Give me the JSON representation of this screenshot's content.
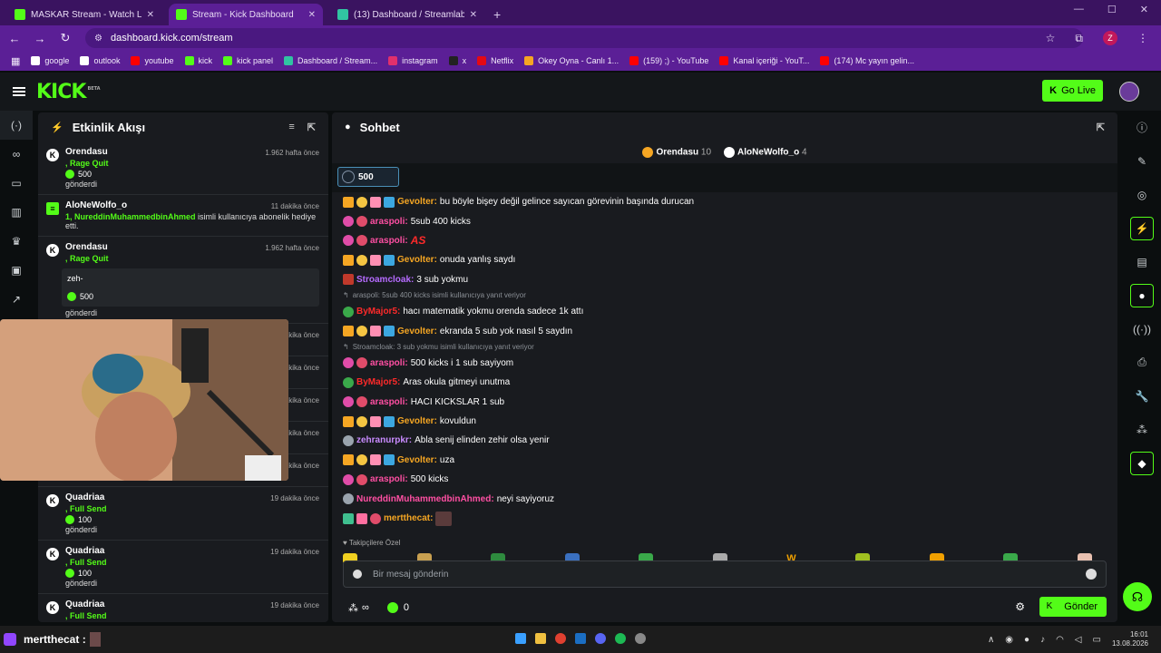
{
  "browser": {
    "tabs": [
      {
        "title": "MASKAR Stream - Watch Live o",
        "color": "#53fc18",
        "active": false
      },
      {
        "title": "Stream - Kick Dashboard",
        "color": "#53fc18",
        "active": true
      },
      {
        "title": "(13) Dashboard / Streamlabs",
        "color": "#31c3a2",
        "active": false
      }
    ],
    "url": "dashboard.kick.com/stream",
    "profile_letter": "Z",
    "bookmarks": [
      {
        "label": "google",
        "color": "#ffffff"
      },
      {
        "label": "outlook",
        "color": "#ffffff"
      },
      {
        "label": "youtube",
        "color": "#ff0000"
      },
      {
        "label": "kick",
        "color": "#53fc18"
      },
      {
        "label": "kick panel",
        "color": "#53fc18"
      },
      {
        "label": "Dashboard / Stream...",
        "color": "#31c3a2"
      },
      {
        "label": "instagram",
        "color": "#e1306c"
      },
      {
        "label": "x",
        "color": "#222222"
      },
      {
        "label": "Netflix",
        "color": "#e50914"
      },
      {
        "label": "Okey Oyna - Canlı 1...",
        "color": "#f5a623"
      },
      {
        "label": "(159) ;) - YouTube",
        "color": "#ff0000"
      },
      {
        "label": "Kanal içeriği - YouT...",
        "color": "#ff0000"
      },
      {
        "label": "(174) Mc yayın gelin...",
        "color": "#ff0000"
      }
    ]
  },
  "header": {
    "logo": "KICK",
    "logo_tag": "BETA",
    "go_live": "Go Live"
  },
  "activity": {
    "title": "Etkinlik Akışı",
    "events": [
      {
        "name": "Orendasu",
        "time": "1.962 hafta önce",
        "sub": ", Rage Quit",
        "amount": "500",
        "sent": "gönderdi",
        "message": ""
      },
      {
        "name": "AloNeWolfo_o",
        "time": "11 dakika önce",
        "gift_user": "1, NureddinMuhammedbinAhmed",
        "gift_text": " isimli kullanıcıya abonelik hediye etti."
      },
      {
        "name": "Orendasu",
        "time": "1.962 hafta önce",
        "sub": ", Rage Quit",
        "amount": "500",
        "sent": "gönderdi",
        "message": "zeh-"
      },
      {
        "name": "Quadriaa",
        "time": "19 dakika önce",
        "sub": ", Full Send",
        "amount": "100",
        "sent": "gönderdi"
      },
      {
        "name": "Quadriaa",
        "time": "19 dakika önce",
        "sub": ", Full Send",
        "amount": "100",
        "sent": "gönderdi"
      },
      {
        "name": "Quadriaa",
        "time": "19 dakika önce",
        "sub": ", Full Send",
        "amount": "100",
        "sent": ""
      }
    ],
    "hidden_times": [
      "dakika önce",
      "dakika önce",
      "dakika önce",
      "dakika önce",
      "dakika önce"
    ]
  },
  "chat": {
    "title": "Sohbet",
    "top_donors": [
      {
        "name": "Orendasu",
        "count": "10",
        "color": "#f5a623"
      },
      {
        "name": "AloNeWolfo_o",
        "count": "4",
        "color": "#ffffff"
      }
    ],
    "pinned_amount": "500",
    "messages": [
      {
        "type": "msg",
        "badges": [
          "crown",
          "one",
          "gift",
          "tool"
        ],
        "user": "Gevolter",
        "color": "#f5a623",
        "text": "bu böyle bişey değil gelince sayıcan görevinin başında durucan"
      },
      {
        "type": "msg",
        "badges": [
          "rank",
          "pig"
        ],
        "user": "araspoli",
        "color": "#ff4fa3",
        "text": "5sub 400 kicks"
      },
      {
        "type": "msg",
        "badges": [
          "rank",
          "pig"
        ],
        "user": "araspoli",
        "color": "#ff4fa3",
        "text": "",
        "emote": "AS"
      },
      {
        "type": "msg",
        "badges": [
          "crown",
          "one",
          "gift",
          "tool"
        ],
        "user": "Gevolter",
        "color": "#f5a623",
        "text": "onuda yanlış saydı"
      },
      {
        "type": "msg",
        "badges": [
          "rob"
        ],
        "user": "Stroamcloak",
        "color": "#b66bff",
        "text": "3 sub yokmu"
      },
      {
        "type": "reply",
        "text": "araspoli: 5sub 400 kicks isimli kullanıcıya yanıt veriyor"
      },
      {
        "type": "msg",
        "badges": [
          "frog"
        ],
        "user": "ByMajor5",
        "color": "#ff2a2a",
        "text": "hacı matematik yokmu orenda sadece 1k attı"
      },
      {
        "type": "msg",
        "badges": [
          "crown",
          "one",
          "gift",
          "tool"
        ],
        "user": "Gevolter",
        "color": "#f5a623",
        "text": "ekranda 5 sub yok nasıl 5 saydın"
      },
      {
        "type": "reply",
        "text": "Stroamcloak: 3 sub yokmu isimli kullanıcıya yanıt veriyor"
      },
      {
        "type": "msg",
        "badges": [
          "rank",
          "pig"
        ],
        "user": "araspoli",
        "color": "#ff4fa3",
        "text": "500 kicks i 1 sub sayiyom"
      },
      {
        "type": "msg",
        "badges": [
          "frog"
        ],
        "user": "ByMajor5",
        "color": "#ff2a2a",
        "text": "Aras okula gitmeyi unutma"
      },
      {
        "type": "msg",
        "badges": [
          "rank",
          "pig"
        ],
        "user": "araspoli",
        "color": "#ff4fa3",
        "text": "HACI KICKSLAR 1 sub"
      },
      {
        "type": "msg",
        "badges": [
          "crown",
          "one",
          "gift",
          "tool"
        ],
        "user": "Gevolter",
        "color": "#f5a623",
        "text": "kovuldun"
      },
      {
        "type": "msg",
        "badges": [
          "cat"
        ],
        "user": "zehranurpkr",
        "color": "#c98bff",
        "text": "Abla senij elinden zehir olsa yenir"
      },
      {
        "type": "msg",
        "badges": [
          "crown",
          "one",
          "gift",
          "tool"
        ],
        "user": "Gevolter",
        "color": "#f5a623",
        "text": "uza"
      },
      {
        "type": "msg",
        "badges": [
          "rank",
          "pig"
        ],
        "user": "araspoli",
        "color": "#ff4fa3",
        "text": "500 kicks"
      },
      {
        "type": "msg",
        "badges": [
          "cat"
        ],
        "user": "NureddinMuhammedbinAhmed",
        "color": "#ff4fa3",
        "text": "neyi sayiyoruz"
      },
      {
        "type": "msg",
        "badges": [
          "sub45",
          "gft2",
          "pig"
        ],
        "user": "mertthecat",
        "color": "#f5a623",
        "text": "",
        "image": true
      }
    ],
    "followers_only": "Takipçilere Özel",
    "emote_colors": [
      "#f0d020",
      "#c8a050",
      "#2e8b3e",
      "#3a70c0",
      "#3aa94a",
      "#aaaaaa",
      "#a0c020",
      "#f0a000",
      "#3aa94a",
      "#e8c0b0"
    ],
    "emote_W": "W",
    "input_placeholder": "Bir mesaj gönderin",
    "points": "∞",
    "kicks": "0",
    "send_label": "Gönder"
  },
  "taskbar": {
    "user": "mertthecat",
    "time": "16:01",
    "date": "13.08.2026"
  }
}
